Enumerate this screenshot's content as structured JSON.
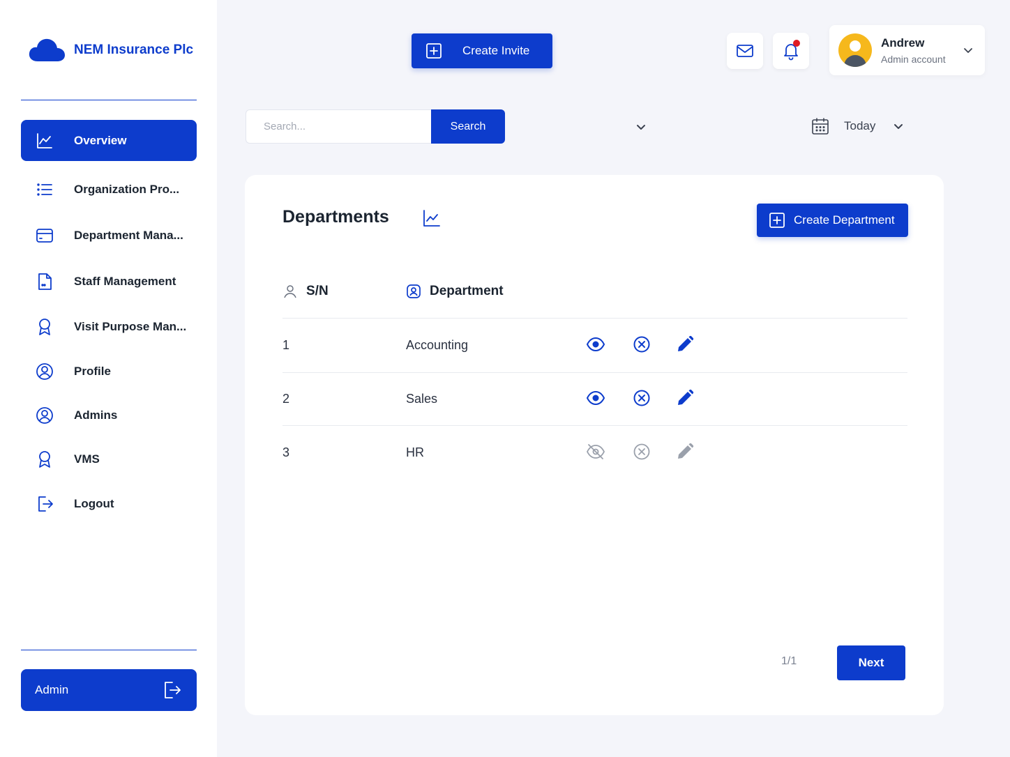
{
  "brand": {
    "name": "NEM Insurance Plc",
    "logo_icon": "cloud-icon",
    "color": "#0d3ccc"
  },
  "sidebar": {
    "items": [
      {
        "label": "Overview",
        "icon": "chart-line-icon",
        "active": true
      },
      {
        "label": "Organization Pro...",
        "icon": "list-icon",
        "active": false
      },
      {
        "label": "Department Mana...",
        "icon": "card-icon",
        "active": false
      },
      {
        "label": "Staff Management",
        "icon": "file-icon",
        "active": false
      },
      {
        "label": "Visit Purpose Man...",
        "icon": "award-icon",
        "active": false
      },
      {
        "label": "Profile",
        "icon": "user-circle-icon",
        "active": false
      },
      {
        "label": "Admins",
        "icon": "user-circle-icon",
        "active": false
      },
      {
        "label": "VMS",
        "icon": "award-icon",
        "active": false
      },
      {
        "label": "Logout",
        "icon": "logout-icon",
        "active": false
      }
    ],
    "admin_button": {
      "label": "Admin",
      "icon": "logout-icon"
    }
  },
  "topbar": {
    "create_invite_label": "Create Invite",
    "mail_icon": "mail-icon",
    "bell_icon": "bell-icon",
    "has_notification": true,
    "user": {
      "name": "Andrew",
      "role": "Admin account"
    }
  },
  "search": {
    "placeholder": "Search...",
    "value": "",
    "button_label": "Search"
  },
  "date_filter": {
    "label": "Today"
  },
  "departments": {
    "title": "Departments",
    "create_button_label": "Create Department",
    "columns": {
      "sn": "S/N",
      "department": "Department"
    },
    "rows": [
      {
        "sn": "1",
        "name": "Accounting",
        "enabled": true
      },
      {
        "sn": "2",
        "name": "Sales",
        "enabled": true
      },
      {
        "sn": "3",
        "name": "HR",
        "enabled": false
      }
    ],
    "pagination": {
      "page": "1/1",
      "next_label": "Next"
    }
  },
  "colors": {
    "primary": "#0d3ccc",
    "background": "#f4f5fa",
    "disabled": "#9aa0ab",
    "alert": "#e01b24"
  }
}
